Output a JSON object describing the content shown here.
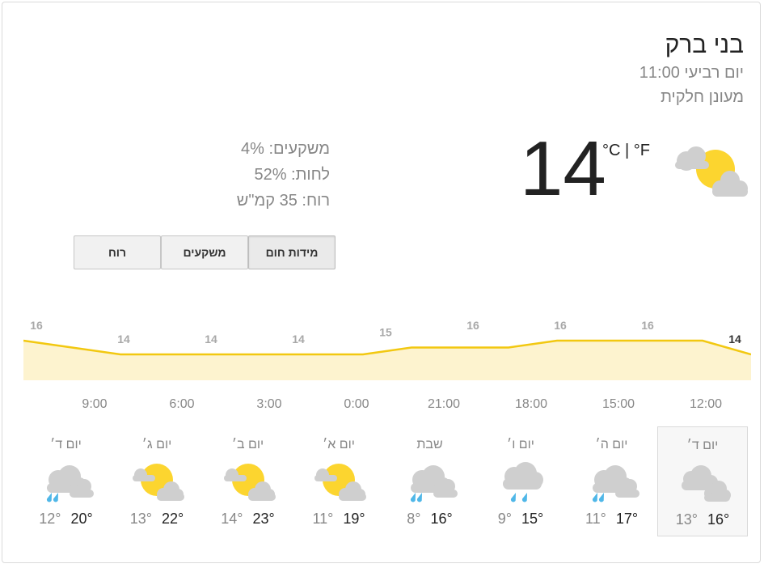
{
  "location": "בני ברק",
  "time": "יום רביעי 11:00",
  "condition": "מעונן חלקית",
  "current": {
    "temp": "14",
    "unit_c": "°C",
    "unit_sep": " | ",
    "unit_f": "°F",
    "icon": "partly-cloudy-icon"
  },
  "stats": {
    "precip": "משקעים: 4%",
    "humidity": "לחות: 52%",
    "wind": "רוח: 35 קמ\"ש"
  },
  "tabs": {
    "temperature": "מידות חום",
    "precipitation": "משקעים",
    "wind": "רוח"
  },
  "chart_data": {
    "type": "area",
    "x": [
      "12:00",
      "15:00",
      "18:00",
      "21:00",
      "0:00",
      "3:00",
      "6:00",
      "9:00"
    ],
    "x_order": "right-to-left",
    "hourly_temps": [
      14,
      16,
      16,
      16,
      16,
      15,
      15,
      15,
      14,
      14,
      14,
      14,
      14,
      14,
      15,
      16
    ],
    "labels": [
      {
        "time": "12:00",
        "value": "14"
      },
      {
        "time": "15:00",
        "value": "16"
      },
      {
        "time": "18:00",
        "value": "16"
      },
      {
        "time": "21:00",
        "value": "16"
      },
      {
        "time": "0:00",
        "value": "15"
      },
      {
        "time": "3:00",
        "value": "14"
      },
      {
        "time": "6:00",
        "value": "14"
      },
      {
        "time": "9:00",
        "value": "14"
      },
      {
        "time": "",
        "value": "16"
      }
    ],
    "line_color": "#f2c811",
    "fill_color": "#fdf3cf"
  },
  "days": [
    {
      "name": "יום ד׳",
      "icon": "cloudy-icon",
      "lo": "13°",
      "hi": "16°",
      "selected": true
    },
    {
      "name": "יום ה׳",
      "icon": "cloud-rain-icon",
      "lo": "11°",
      "hi": "17°"
    },
    {
      "name": "יום ו׳",
      "icon": "showers-icon",
      "lo": "9°",
      "hi": "15°"
    },
    {
      "name": "שבת",
      "icon": "cloud-rain-icon",
      "lo": "8°",
      "hi": "16°"
    },
    {
      "name": "יום א׳",
      "icon": "partly-cloudy-icon",
      "lo": "11°",
      "hi": "19°"
    },
    {
      "name": "יום ב׳",
      "icon": "partly-cloudy-icon",
      "lo": "14°",
      "hi": "23°"
    },
    {
      "name": "יום ג׳",
      "icon": "partly-cloudy-icon",
      "lo": "13°",
      "hi": "22°"
    },
    {
      "name": "יום ד׳",
      "icon": "cloud-rain-icon",
      "lo": "12°",
      "hi": "20°"
    }
  ]
}
